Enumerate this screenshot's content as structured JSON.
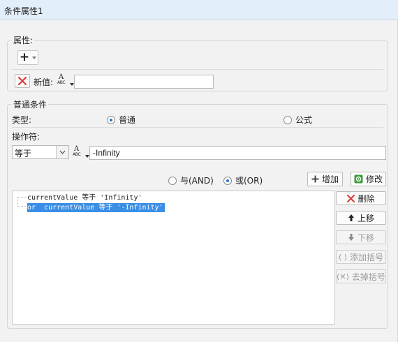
{
  "window": {
    "title": "条件属性1"
  },
  "attributes": {
    "group_title": "属性:",
    "add_button_glyph": "+",
    "new_value_label": "新值:",
    "new_value": ""
  },
  "condition": {
    "group_title": "普通条件",
    "type_label": "类型:",
    "type_options": [
      "普通",
      "公式"
    ],
    "type_selected": "普通",
    "operator_label": "操作符:",
    "operator_value": "等于",
    "operand_value": "-Infinity"
  },
  "logic": {
    "and_label": "与(AND)",
    "or_label": "或(OR)",
    "selected": "或(OR)",
    "add_button": "增加",
    "modify_button": "修改"
  },
  "condition_list": {
    "rows": [
      "currentValue 等于 'Infinity'",
      "or  currentValue 等于 '-Infinity'"
    ],
    "selected_index": 1
  },
  "side_buttons": {
    "delete": "删除",
    "move_up": "上移",
    "move_down": "下移",
    "add_bracket": "添加括号",
    "remove_bracket": "去掉括号"
  },
  "colors": {
    "selection": "#3a8ee6",
    "delete_red": "#e03a3a",
    "radio_dot": "#2a6fd6"
  }
}
